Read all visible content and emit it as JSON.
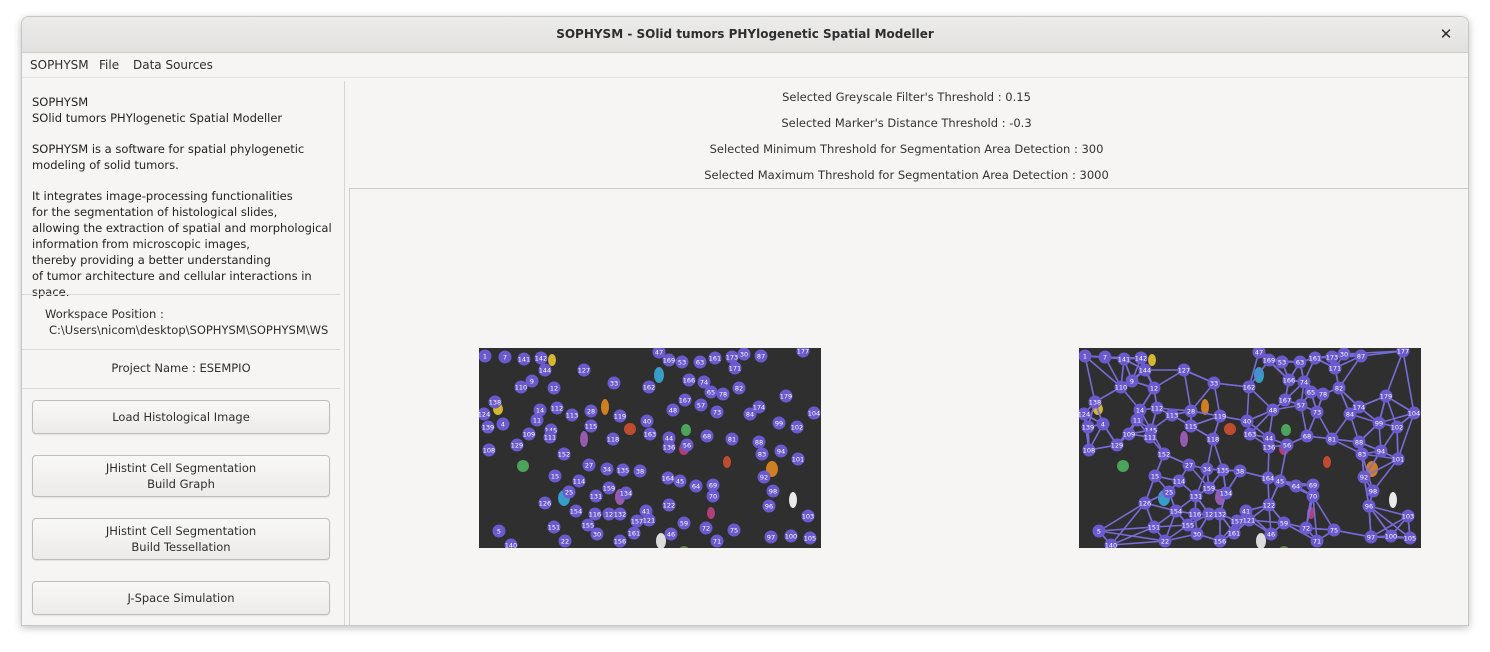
{
  "window": {
    "title": "SOPHYSM - SOlid tumors PHYlogenetic Spatial Modeller",
    "close_icon": "✕"
  },
  "menu": [
    "SOPHYSM",
    "File",
    "Data Sources"
  ],
  "sidebar": {
    "about": [
      [
        "SOPHYSM",
        "SOlid tumors PHYlogenetic Spatial Modeller"
      ],
      [
        "SOPHYSM is a software for spatial phylogenetic",
        "modeling of solid tumors."
      ],
      [
        "It integrates image-processing functionalities",
        "for the segmentation of histological slides,",
        "allowing the extraction of spatial and morphological",
        "information from microscopic images,",
        "thereby providing a better understanding",
        "of tumor architecture and cellular interactions in space."
      ]
    ],
    "workspace_label": "Workspace Position :",
    "workspace_path": "C:\\Users\\nicom\\desktop\\SOPHYSM\\SOPHYSM\\WS",
    "project_label": "Project Name : ESEMPIO",
    "buttons": [
      [
        "Load Histological Image"
      ],
      [
        "JHistint Cell Segmentation",
        "Build Graph"
      ],
      [
        "JHistint Cell Segmentation",
        "Build Tessellation"
      ],
      [
        "J-Space Simulation"
      ]
    ]
  },
  "thresholds": [
    "Selected Greyscale Filter's Threshold : 0.15",
    "Selected Marker's Distance Threshold : -0.3",
    "Selected Minimum Threshold for Segmentation Area Detection : 300",
    "Selected Maximum Threshold for Segmentation Area Detection : 3000"
  ],
  "colors": {
    "node_fill": "#6a5acd",
    "edge": "#7b6fe0",
    "image_bg": "#2f2f2f"
  },
  "image_left": {
    "name": "segmented-image",
    "show_edges": false
  },
  "image_right": {
    "name": "graph-image",
    "show_edges": true
  },
  "nodes": [
    {
      "label": "1"
    },
    {
      "label": "7"
    },
    {
      "label": "141"
    },
    {
      "label": "142"
    },
    {
      "label": "144"
    },
    {
      "label": "127"
    },
    {
      "label": "47"
    },
    {
      "label": "169"
    },
    {
      "label": "53"
    },
    {
      "label": "63"
    },
    {
      "label": "161"
    },
    {
      "label": "173"
    },
    {
      "label": "30"
    },
    {
      "label": "87"
    },
    {
      "label": "177"
    },
    {
      "label": "110"
    },
    {
      "label": "9"
    },
    {
      "label": "12"
    },
    {
      "label": "33"
    },
    {
      "label": "162"
    },
    {
      "label": "166"
    },
    {
      "label": "74"
    },
    {
      "label": "65"
    },
    {
      "label": "78"
    },
    {
      "label": "82"
    },
    {
      "label": "171"
    },
    {
      "label": "138"
    },
    {
      "label": "14"
    },
    {
      "label": "112"
    },
    {
      "label": "113"
    },
    {
      "label": "28"
    },
    {
      "label": "119"
    },
    {
      "label": "40"
    },
    {
      "label": "48"
    },
    {
      "label": "167"
    },
    {
      "label": "57"
    },
    {
      "label": "73"
    },
    {
      "label": "84"
    },
    {
      "label": "174"
    },
    {
      "label": "179"
    },
    {
      "label": "104"
    },
    {
      "label": "124"
    },
    {
      "label": "11"
    },
    {
      "label": "115"
    },
    {
      "label": "139"
    },
    {
      "label": "4"
    },
    {
      "label": "145"
    },
    {
      "label": "111"
    },
    {
      "label": "163"
    },
    {
      "label": "44"
    },
    {
      "label": "136"
    },
    {
      "label": "56"
    },
    {
      "label": "68"
    },
    {
      "label": "81"
    },
    {
      "label": "88"
    },
    {
      "label": "99"
    },
    {
      "label": "102"
    },
    {
      "label": "108"
    },
    {
      "label": "129"
    },
    {
      "label": "109"
    },
    {
      "label": "118"
    },
    {
      "label": "152"
    },
    {
      "label": "27"
    },
    {
      "label": "34"
    },
    {
      "label": "135"
    },
    {
      "label": "38"
    },
    {
      "label": "83"
    },
    {
      "label": "94"
    },
    {
      "label": "101"
    },
    {
      "label": "15"
    },
    {
      "label": "114"
    },
    {
      "label": "25"
    },
    {
      "label": "159"
    },
    {
      "label": "131"
    },
    {
      "label": "134"
    },
    {
      "label": "164"
    },
    {
      "label": "45"
    },
    {
      "label": "64"
    },
    {
      "label": "69"
    },
    {
      "label": "70"
    },
    {
      "label": "92"
    },
    {
      "label": "98"
    },
    {
      "label": "126"
    },
    {
      "label": "154"
    },
    {
      "label": "116"
    },
    {
      "label": "12"
    },
    {
      "label": "132"
    },
    {
      "label": "122"
    },
    {
      "label": "41"
    },
    {
      "label": "121"
    },
    {
      "label": "157"
    },
    {
      "label": "96"
    },
    {
      "label": "103"
    },
    {
      "label": "5"
    },
    {
      "label": "151"
    },
    {
      "label": "155"
    },
    {
      "label": "30"
    },
    {
      "label": "161"
    },
    {
      "label": "59"
    },
    {
      "label": "72"
    },
    {
      "label": "75"
    },
    {
      "label": "46"
    },
    {
      "label": "97"
    },
    {
      "label": "100"
    },
    {
      "label": "105"
    },
    {
      "label": "140"
    },
    {
      "label": "22"
    },
    {
      "label": "156"
    },
    {
      "label": "71"
    }
  ]
}
